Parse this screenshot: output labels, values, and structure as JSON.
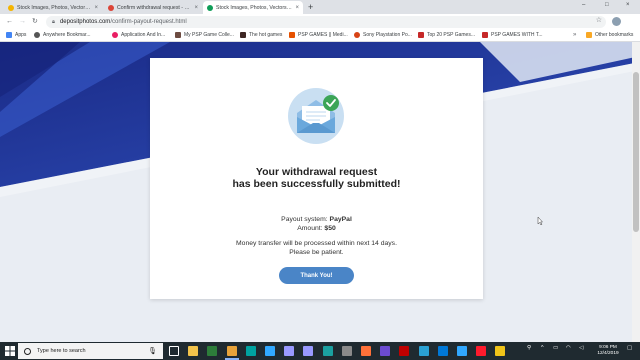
{
  "browser": {
    "tabs": [
      {
        "title": "Stock Images, Photos, Vectors, Vi...",
        "active": false,
        "favicon_color": "#f4b400"
      },
      {
        "title": "Confirm withdrawal request - pho...",
        "active": false,
        "favicon_color": "#db4437"
      },
      {
        "title": "Stock Images, Photos, Vectors, Vi...",
        "active": true,
        "favicon_color": "#0f9d58"
      }
    ],
    "close_glyph": "×",
    "new_tab_glyph": "+",
    "window_controls": [
      "–",
      "□",
      "×"
    ],
    "url": {
      "host": "depositphotos.com",
      "path": "/confirm-payout-request.html"
    },
    "bookmarks": [
      {
        "label": "Apps",
        "icon_color": "#4285f4"
      },
      {
        "label": "Anywhere Bookmar...",
        "icon_color": "#555555"
      },
      {
        "label": "Application And In...",
        "icon_color": "#e91e63"
      },
      {
        "label": "My PSP Game Colle...",
        "icon_color": "#6d4c41"
      },
      {
        "label": "The hot games",
        "icon_color": "#3e2723"
      },
      {
        "label": "PSP GAMES || Medi...",
        "icon_color": "#e65100"
      },
      {
        "label": "Sony Playstation Po...",
        "icon_color": "#d84315"
      },
      {
        "label": "Top 20 PSP Games...",
        "icon_color": "#c62828"
      },
      {
        "label": "PSP GAMES WITH T...",
        "icon_color": "#c62828"
      },
      {
        "label": "Other bookmarks",
        "icon_color": "#f9a825"
      }
    ],
    "more_glyph": "»"
  },
  "page": {
    "heading_line1": "Your withdrawal request",
    "heading_line2": "has been successfully submitted!",
    "payout_label": "Payout system:",
    "payout_value": "PayPal",
    "amount_label": "Amount:",
    "amount_value": "$50",
    "note_line1": "Money transfer will be processed within next 14 days.",
    "note_line2": "Please be patient.",
    "button_label": "Thank You!",
    "colors": {
      "accent": "#4a85c7",
      "hero_dark": "#1d2f8f",
      "hero_mid": "#3151b8"
    }
  },
  "taskbar": {
    "search_placeholder": "Type here to search",
    "time": "9:06 PM",
    "date": "12/4/2019",
    "apps": [
      {
        "name": "task-view-icon",
        "color": "#ffffff"
      },
      {
        "name": "file-explorer-icon",
        "color": "#f2c34b"
      },
      {
        "name": "store-icon",
        "color": "#2d7d3a"
      },
      {
        "name": "chrome-icon",
        "color": "#e8a33a"
      },
      {
        "name": "audition-icon",
        "color": "#00a3a1"
      },
      {
        "name": "photoshop-icon",
        "color": "#31a8ff"
      },
      {
        "name": "after-effects-icon",
        "color": "#9999ff"
      },
      {
        "name": "premiere-icon",
        "color": "#9999ff"
      },
      {
        "name": "app-teal-icon",
        "color": "#1ba0a0"
      },
      {
        "name": "app-gray-icon",
        "color": "#8a8a8a"
      },
      {
        "name": "firefox-icon",
        "color": "#ff7139"
      },
      {
        "name": "media-icon",
        "color": "#6b4bd1"
      },
      {
        "name": "filezilla-icon",
        "color": "#bf0000"
      },
      {
        "name": "app-x-icon",
        "color": "#2aa1d3"
      },
      {
        "name": "app-blue-icon",
        "color": "#0078d7"
      },
      {
        "name": "lightroom-icon",
        "color": "#31a8ff"
      },
      {
        "name": "opera-icon",
        "color": "#ff1b2d"
      },
      {
        "name": "app-yellow-icon",
        "color": "#f0c419"
      }
    ]
  }
}
